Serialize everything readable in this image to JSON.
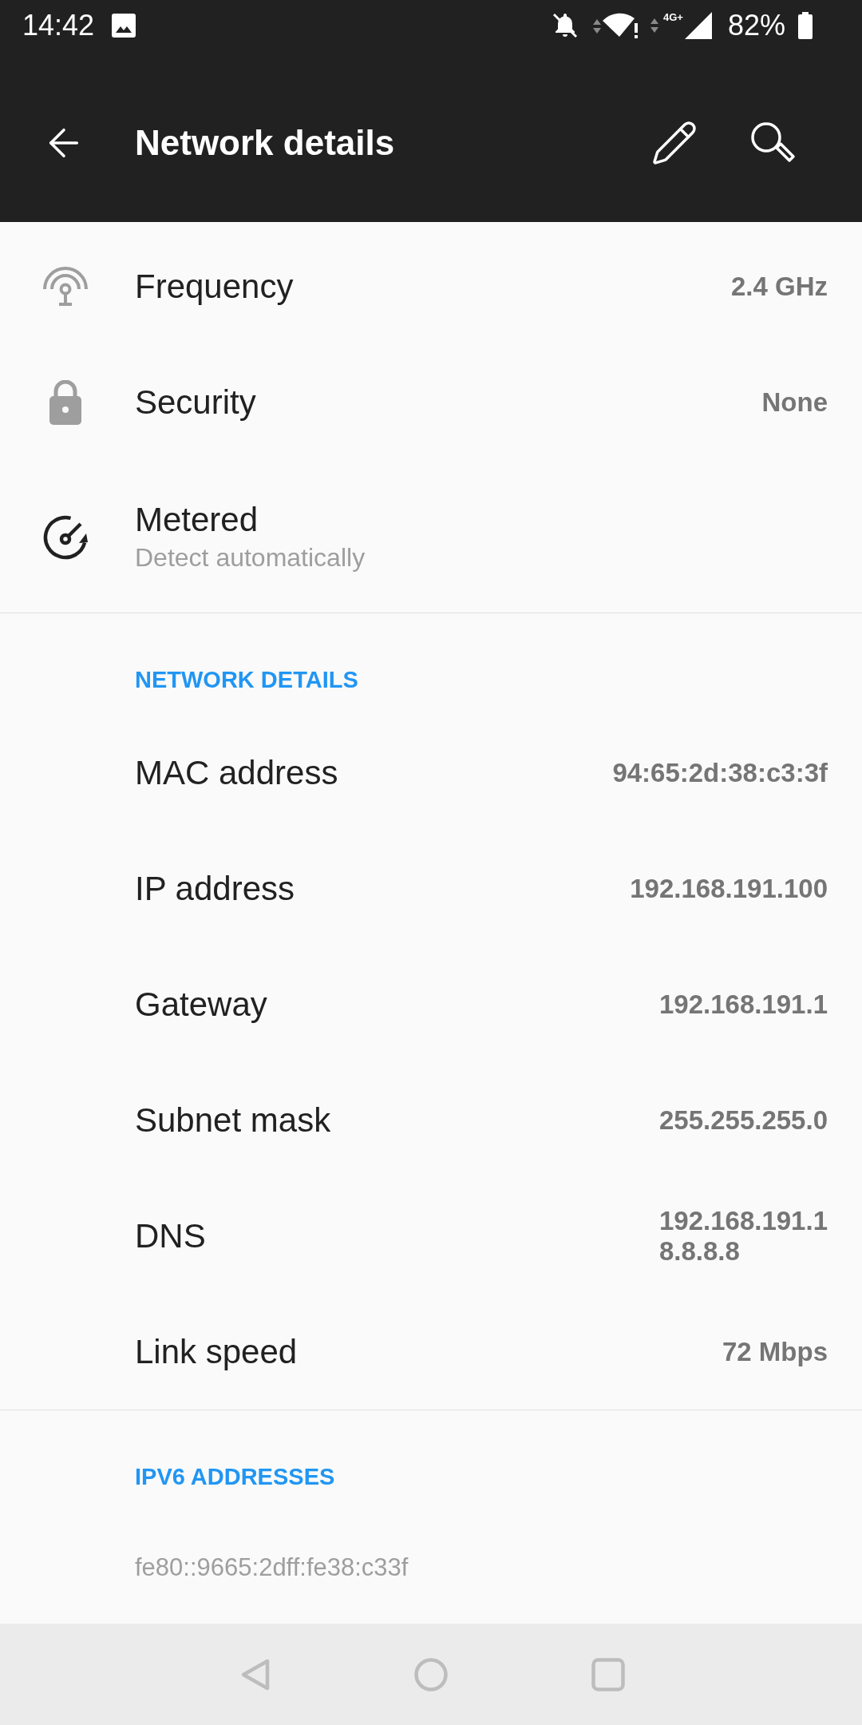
{
  "status_bar": {
    "time": "14:42",
    "network_type": "4G+",
    "battery": "82%"
  },
  "toolbar": {
    "title": "Network details"
  },
  "summary": [
    {
      "label": "Frequency",
      "value": "2.4 GHz"
    },
    {
      "label": "Security",
      "value": "None"
    },
    {
      "label": "Metered",
      "subtitle": "Detect automatically"
    }
  ],
  "network_details": {
    "title": "NETWORK DETAILS",
    "rows": [
      {
        "label": "MAC address",
        "values": [
          "94:65:2d:38:c3:3f"
        ]
      },
      {
        "label": "IP address",
        "values": [
          "192.168.191.100"
        ]
      },
      {
        "label": "Gateway",
        "values": [
          "192.168.191.1"
        ]
      },
      {
        "label": "Subnet mask",
        "values": [
          "255.255.255.0"
        ]
      },
      {
        "label": "DNS",
        "values": [
          "192.168.191.1",
          "8.8.8.8"
        ]
      },
      {
        "label": "Link speed",
        "values": [
          "72 Mbps"
        ]
      }
    ]
  },
  "ipv6": {
    "title": "IPV6 ADDRESSES",
    "addresses": [
      "fe80::9665:2dff:fe38:c33f"
    ]
  }
}
